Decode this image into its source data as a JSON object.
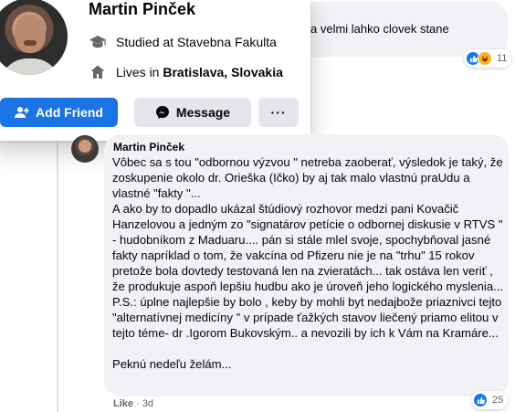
{
  "top_comment": {
    "snippet": "a velmi lahko clovek stane",
    "reaction_count": "11"
  },
  "hovercard": {
    "name": "Martin Pinček",
    "studied_prefix": "Studied at ",
    "studied_place": "Stavebna Fakulta",
    "lives_prefix": "Lives in ",
    "lives_place": "Bratislava, Slovakia",
    "add_friend_label": "Add Friend",
    "message_label": "Message",
    "more_label": "···",
    "icons": [
      "graduation-cap-icon",
      "house-icon",
      "add-friend-icon",
      "messenger-icon"
    ]
  },
  "comment": {
    "author": "Martin Pinček",
    "text": "Vôbec sa s tou \"odbornou výzvou \" netreba zaoberať, výsledok je taký, že zoskupenie okolo dr. Orieška (Ičko) by aj tak malo vlastnú praUdu a vlastné \"fakty \"...\nA ako by to dopadlo ukázal štúdiový rozhovor medzi pani Kovačič Hanzelovou a jedným zo \"signatárov petície o odbornej diskusie v RTVS \" - hudobníkom z Maduaru.... pán si stále mlel svoje, spochybňoval jasné fakty napríklad o tom, že vakcína od Pfizeru nie je na \"trhu\" 15 rokov pretože bola dovtedy testovaná len na zvieratách... tak ostáva len veriť , že produkuje aspoň lepšiu hudbu ako je úroveň jeho logického myslenia...\nP.S.: úplne najlepšie by bolo , keby by mohli byt nedajbože priaznivci tejto \"alternatívnej medicíny \" v prípade ťažkých stavov liečený priamo elitou v tejto téme- dr .Igorom Bukovským.. a nevozili by ich k Vám na Kramáre...\n\nPeknú nedeľu želám...",
    "reaction_count": "25",
    "like_label": "Like",
    "separator": "·",
    "time": "3d"
  },
  "colors": {
    "accent": "#1b74e4",
    "bubble": "#f0f2f5",
    "secondary_text": "#65676b"
  }
}
